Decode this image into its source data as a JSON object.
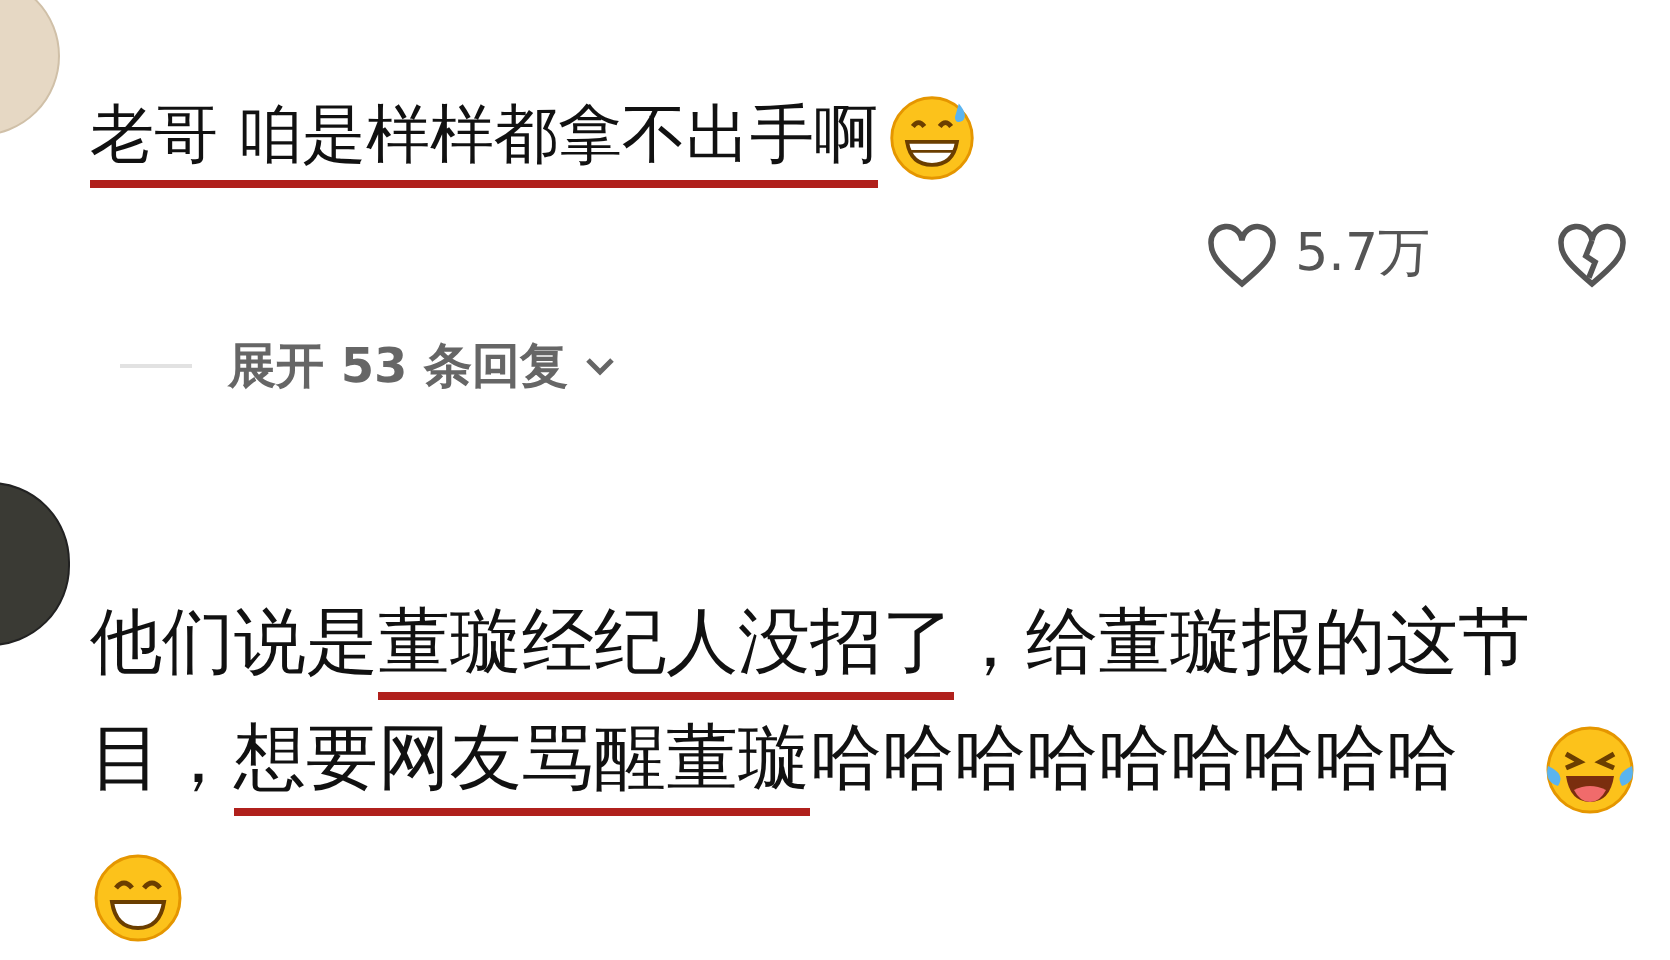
{
  "comments": [
    {
      "segments": [
        {
          "text": "老哥 咱是样样都拿不出手啊",
          "underlined": true
        }
      ],
      "emojis": [
        {
          "kind": "grin_sweat"
        }
      ],
      "likes": "5.7万",
      "liked": false,
      "replies_link": "展开 53 条回复"
    },
    {
      "segments": [
        {
          "text": "他们说是",
          "underlined": false
        },
        {
          "text": "董璇经纪人没招了",
          "underlined": true
        },
        {
          "text": "，给董璇报的这节目，",
          "underlined": false
        },
        {
          "text": "想要网友骂醒董璇",
          "underlined": true
        },
        {
          "text": "哈哈哈哈哈哈哈哈哈",
          "underlined": false
        }
      ],
      "emojis": [
        {
          "kind": "tears_laugh"
        },
        {
          "kind": "grin"
        }
      ]
    }
  ]
}
